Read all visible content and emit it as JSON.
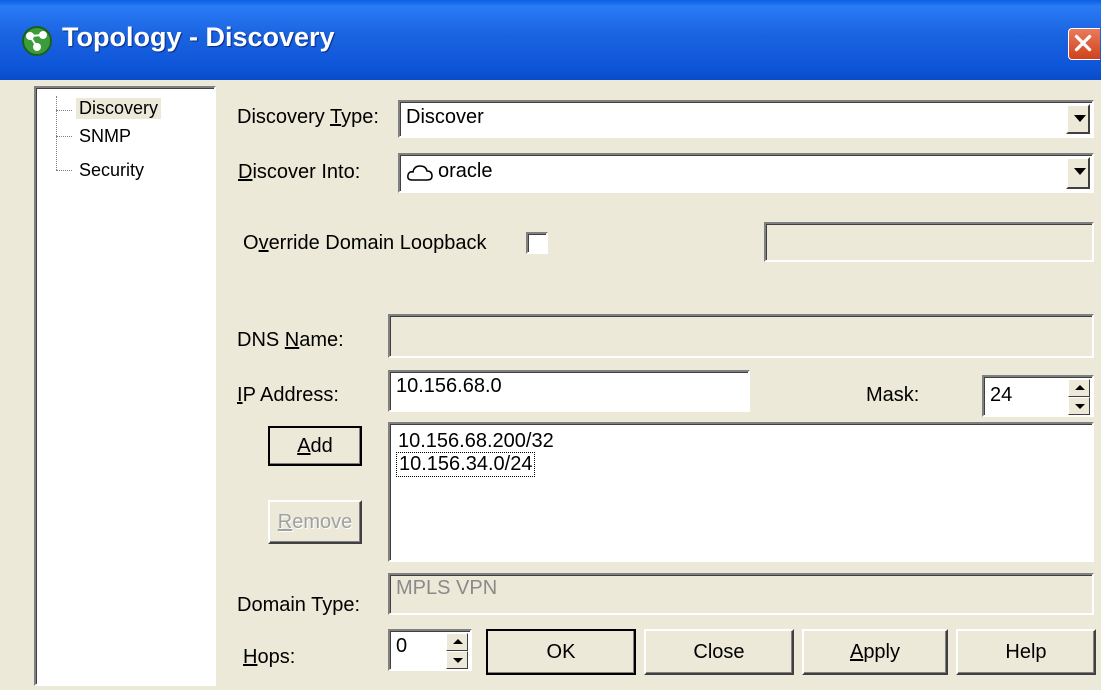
{
  "window": {
    "title": "Topology - Discovery",
    "icon": "topology-app-icon",
    "close_icon": "close-x-icon"
  },
  "tree": {
    "items": [
      {
        "label": "Discovery",
        "selected": true
      },
      {
        "label": "SNMP",
        "selected": false
      },
      {
        "label": "Security",
        "selected": false
      }
    ]
  },
  "form": {
    "discovery_type": {
      "label_pre": "Discovery ",
      "label_ul": "T",
      "label_post": "ype:",
      "value": "Discover"
    },
    "discover_into": {
      "label_pre": "",
      "label_ul": "D",
      "label_post": "iscover Into:",
      "value": "oracle",
      "icon": "cloud-icon"
    },
    "override": {
      "label_pre": "O",
      "label_ul": "v",
      "label_post": "erride Domain Loopback",
      "checked": false,
      "value": ""
    },
    "dns_name": {
      "label_pre": "DNS ",
      "label_ul": "N",
      "label_post": "ame:",
      "value": ""
    },
    "ip_address": {
      "label_pre": "",
      "label_ul": "I",
      "label_post": "P Address:",
      "value": "10.156.68.0"
    },
    "mask": {
      "label": "Mask:",
      "value": "24"
    },
    "address_list": [
      "10.156.68.200/32",
      "10.156.34.0/24"
    ],
    "domain_type": {
      "label": "Domain Type:",
      "value": "MPLS VPN"
    },
    "hops": {
      "label_pre": "",
      "label_ul": "H",
      "label_post": "ops:",
      "value": "0"
    }
  },
  "buttons": {
    "add": {
      "ul": "A",
      "rest": "dd"
    },
    "remove": {
      "ul": "R",
      "rest": "emove"
    },
    "ok": "OK",
    "close": "Close",
    "apply": {
      "ul": "A",
      "rest": "pply"
    },
    "help": "Help"
  },
  "colors": {
    "titlebar": "#0a5fe4",
    "face": "#ece9d8",
    "close_button": "#d0411c"
  }
}
